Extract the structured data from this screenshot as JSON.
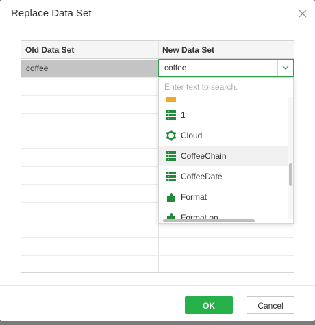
{
  "dialog": {
    "title": "Replace Data Set",
    "close_icon": "close-icon"
  },
  "grid": {
    "columns": [
      "Old Data Set",
      "New Data Set"
    ],
    "rows": [
      {
        "old": "coffee",
        "new": "coffee"
      }
    ]
  },
  "select": {
    "value": "coffee",
    "arrow_icon": "chevron-down-icon"
  },
  "dropdown": {
    "search_placeholder": "Enter text to search.",
    "items": [
      {
        "label": "",
        "icon": "folder-icon"
      },
      {
        "label": "1",
        "icon": "table-icon"
      },
      {
        "label": "Cloud",
        "icon": "gear-cloud-icon"
      },
      {
        "label": "CoffeeChain",
        "icon": "table-icon",
        "highlighted": true
      },
      {
        "label": "CoffeeDate",
        "icon": "table-icon"
      },
      {
        "label": "Format",
        "icon": "puzzle-icon"
      },
      {
        "label": "Format on",
        "icon": "puzzle-icon"
      }
    ]
  },
  "footer": {
    "ok_label": "OK",
    "cancel_label": "Cancel"
  },
  "colors": {
    "accent": "#25b049",
    "icon_green": "#1e8a3a",
    "folder_orange": "#f5a623",
    "selected_cell": "#c4c4c4"
  }
}
